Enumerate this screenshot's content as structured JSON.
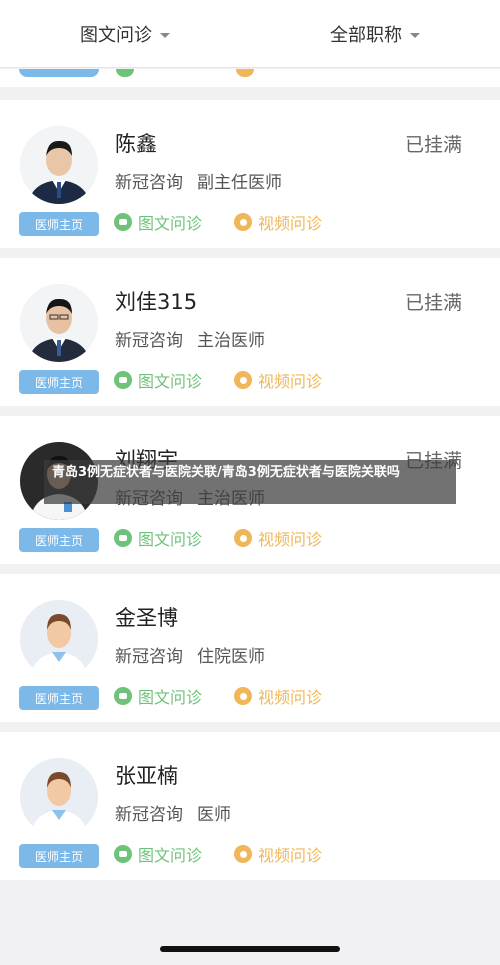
{
  "filters": {
    "type_label": "图文问诊",
    "title_label": "全部职称"
  },
  "home_button_label": "医师主页",
  "consult_text_label": "图文问诊",
  "consult_video_label": "视频问诊",
  "colors": {
    "home_button": "#7db9e8",
    "text_consult": "#6fc27a",
    "video_consult": "#f0b75a"
  },
  "doctors": [
    {
      "name": "陈鑫",
      "service": "新冠咨询",
      "title": "副主任医师",
      "status": "已挂满",
      "avatar_icon": "doctor-photo-icon"
    },
    {
      "name": "刘佳315",
      "service": "新冠咨询",
      "title": "主治医师",
      "status": "已挂满",
      "avatar_icon": "doctor-photo-icon"
    },
    {
      "name": "刘翔宇",
      "service": "新冠咨询",
      "title": "主治医师",
      "status": "已挂满",
      "avatar_icon": "doctor-photo-icon"
    },
    {
      "name": "金圣博",
      "service": "新冠咨询",
      "title": "住院医师",
      "status": "",
      "avatar_icon": "default-doctor-avatar-icon"
    },
    {
      "name": "张亚楠",
      "service": "新冠咨询",
      "title": "医师",
      "status": "",
      "avatar_icon": "default-doctor-avatar-icon"
    }
  ],
  "overlay_caption": "青岛3例无症状者与医院关联/青岛3例无症状者与医院关联吗"
}
